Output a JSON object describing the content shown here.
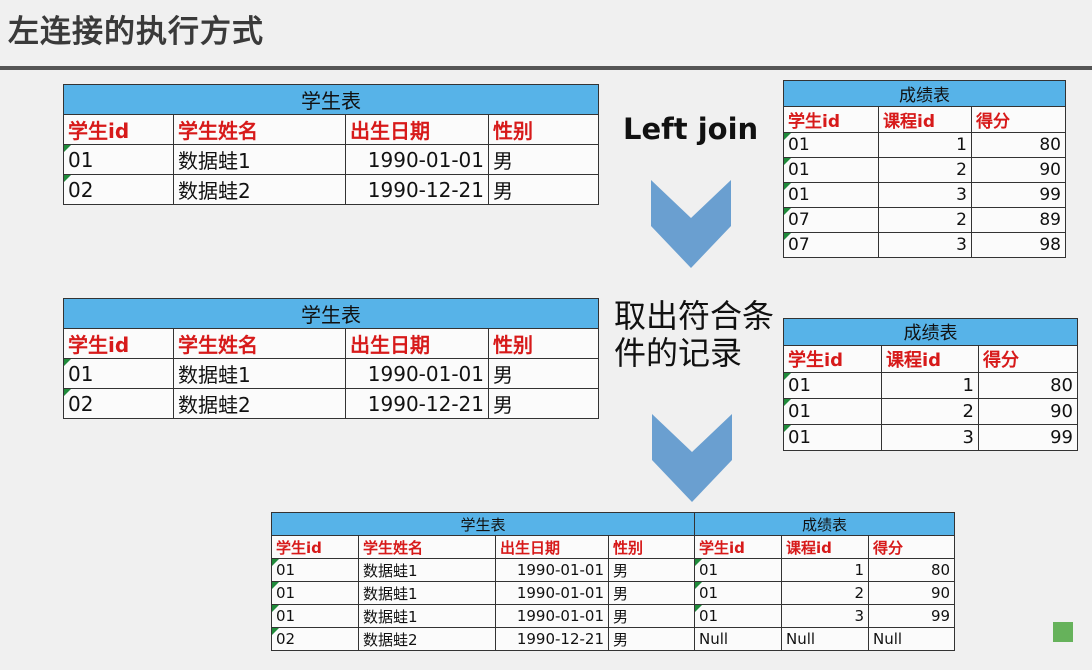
{
  "title": "左连接的执行方式",
  "join_label": "Left join",
  "mid_label": "取出符合条件的记录",
  "student_table": {
    "caption": "学生表",
    "headers": [
      "学生id",
      "学生姓名",
      "出生日期",
      "性别"
    ],
    "rows": [
      [
        "01",
        "数据蛙1",
        "1990-01-01",
        "男"
      ],
      [
        "02",
        "数据蛙2",
        "1990-12-21",
        "男"
      ]
    ]
  },
  "score_table": {
    "caption": "成绩表",
    "headers": [
      "学生id",
      "课程id",
      "得分"
    ],
    "rows": [
      [
        "01",
        "1",
        "80"
      ],
      [
        "01",
        "2",
        "90"
      ],
      [
        "01",
        "3",
        "99"
      ],
      [
        "07",
        "2",
        "89"
      ],
      [
        "07",
        "3",
        "98"
      ]
    ]
  },
  "filtered_score_table": {
    "caption": "成绩表",
    "headers": [
      "学生id",
      "课程id",
      "得分"
    ],
    "rows": [
      [
        "01",
        "1",
        "80"
      ],
      [
        "01",
        "2",
        "90"
      ],
      [
        "01",
        "3",
        "99"
      ]
    ]
  },
  "result_table": {
    "caption_left": "学生表",
    "caption_right": "成绩表",
    "headers": [
      "学生id",
      "学生姓名",
      "出生日期",
      "性别",
      "学生id",
      "课程id",
      "得分"
    ],
    "rows": [
      [
        "01",
        "数据蛙1",
        "1990-01-01",
        "男",
        "01",
        "1",
        "80"
      ],
      [
        "01",
        "数据蛙1",
        "1990-01-01",
        "男",
        "01",
        "2",
        "90"
      ],
      [
        "01",
        "数据蛙1",
        "1990-01-01",
        "男",
        "01",
        "3",
        "99"
      ],
      [
        "02",
        "数据蛙2",
        "1990-12-21",
        "男",
        "Null",
        "Null",
        "Null"
      ]
    ]
  },
  "colors": {
    "caption_bg": "#57b3e8",
    "header_text": "#d71a1a",
    "arrow": "#6a9fd0",
    "corner_square": "#66b25b"
  },
  "icons": [
    "chevron-down-arrow",
    "chevron-down-arrow"
  ]
}
